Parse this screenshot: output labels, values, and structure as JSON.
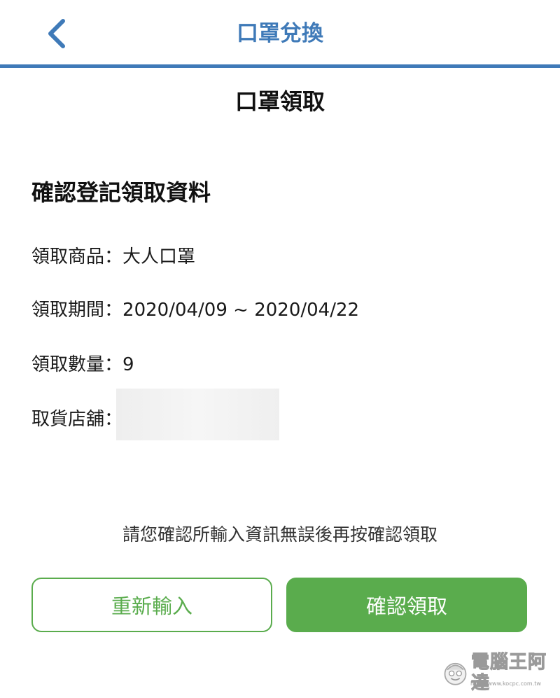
{
  "navbar": {
    "title": "口罩兌換",
    "back_icon": "chevron-left-icon",
    "accent_color": "#3f7ab8"
  },
  "page": {
    "title": "口罩領取",
    "section_title": "確認登記領取資料"
  },
  "info": {
    "product_label": "領取商品",
    "product_value": "大人口罩",
    "period_label": "領取期間",
    "period_value": "2020/04/09 ~ 2020/04/22",
    "quantity_label": "領取數量",
    "quantity_value": "9",
    "store_label": "取貨店舖",
    "separator": "："
  },
  "notice": "請您確認所輸入資訊無誤後再按確認領取",
  "buttons": {
    "reenter_label": "重新輸入",
    "confirm_label": "確認領取",
    "primary_color": "#5aac4d"
  },
  "watermark": {
    "text": "電腦王阿達",
    "url": "http://www.kocpc.com.tw",
    "icon": "mascot-face-icon"
  }
}
